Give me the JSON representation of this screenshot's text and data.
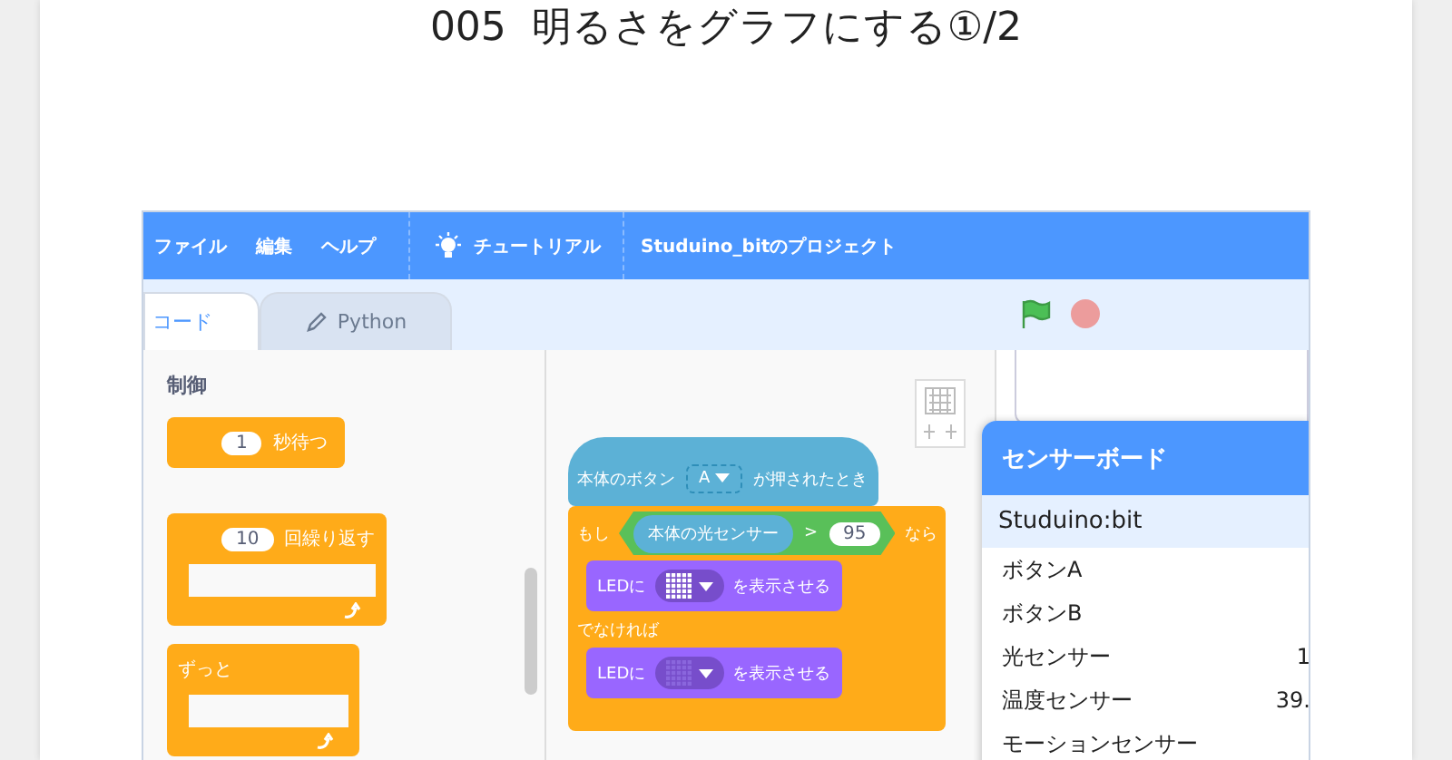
{
  "title": "005  明るさをグラフにする①/2",
  "menu": [
    {
      "label": "ファイル"
    },
    {
      "label": "編集"
    },
    {
      "label": "ヘルプ"
    }
  ],
  "tutorial": "チュートリアル",
  "project_title": "Studuino_bitのプロジェクト",
  "tabs": [
    {
      "label": "コード",
      "selected": true
    },
    {
      "label": "Python",
      "selected": false
    }
  ],
  "palette": {
    "category": "制御",
    "blocks": [
      {
        "kind": "stack",
        "input": "1",
        "label": "秒待つ"
      },
      {
        "kind": "c",
        "input": "10",
        "label": "回繰り返す"
      },
      {
        "kind": "c",
        "label": "ずっと"
      }
    ]
  },
  "script": {
    "hat": {
      "before": "本体のボタン",
      "dropdown": "A",
      "after": "が押されたとき"
    },
    "if_else": {
      "if_label": "もし",
      "condition": {
        "reporter": "本体の光センサー",
        "operator": ">",
        "value": "95"
      },
      "then_label": "なら",
      "then": [
        {
          "before": "LEDに",
          "lit": true,
          "after": "を表示させる"
        }
      ],
      "else_label": "でなければ",
      "else": [
        {
          "before": "LEDに",
          "lit": false,
          "after": "を表示させる"
        }
      ]
    }
  },
  "sensor_board": {
    "title": "センサーボード",
    "device": "Studuino:bit",
    "rows": [
      {
        "label": "ボタンA"
      },
      {
        "label": "ボタンB"
      },
      {
        "label": "光センサー",
        "value": "1"
      },
      {
        "label": "温度センサー",
        "value": "39."
      },
      {
        "label": "モーションセンサー"
      }
    ]
  }
}
